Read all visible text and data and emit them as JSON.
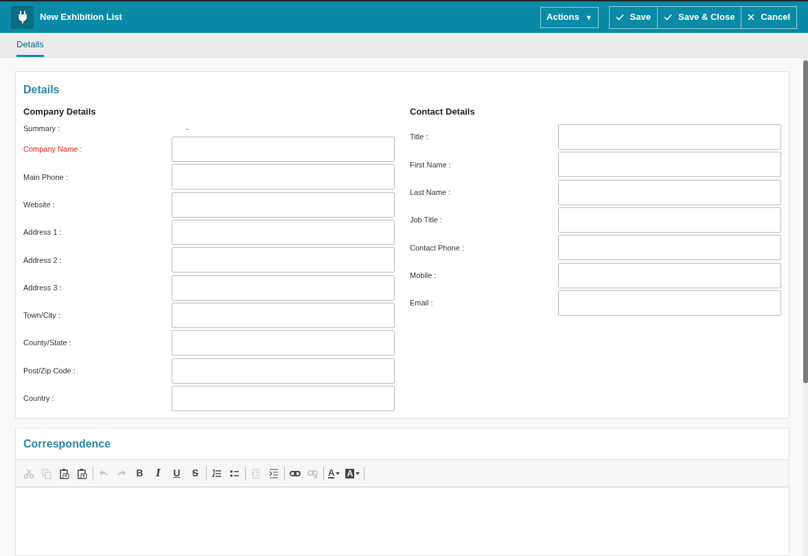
{
  "header": {
    "title": "New Exhibition List",
    "actions_button": {
      "label": "Actions",
      "caret": "▼"
    },
    "buttons": [
      {
        "kind": "save",
        "label": "Save"
      },
      {
        "kind": "save-close",
        "label": "Save & Close"
      },
      {
        "kind": "cancel",
        "label": "Cancel"
      }
    ]
  },
  "tabs": [
    {
      "label": "Details",
      "selected": true
    }
  ],
  "details": {
    "title": "Details",
    "company": {
      "title": "Company Details",
      "summary": {
        "label": "Summary :",
        "value": "-"
      },
      "fields": [
        {
          "label": "Company Name :",
          "required": true
        },
        {
          "label": "Main Phone :",
          "required": false
        },
        {
          "label": "Website :",
          "required": false
        },
        {
          "label": "Address 1 :",
          "required": false
        },
        {
          "label": "Address 2 :",
          "required": false
        },
        {
          "label": "Address 3 :",
          "required": false
        },
        {
          "label": "Town/City :",
          "required": false
        },
        {
          "label": "County/State :",
          "required": false
        },
        {
          "label": "Post/Zip Code :",
          "required": false
        },
        {
          "label": "Country :",
          "required": false
        }
      ]
    },
    "contact": {
      "title": "Contact Details",
      "fields": [
        {
          "label": "Title :",
          "required": false
        },
        {
          "label": "First Name :",
          "required": false
        },
        {
          "label": "Last Name :",
          "required": false
        },
        {
          "label": "Job Title :",
          "required": false
        },
        {
          "label": "Contact Phone :",
          "required": false
        },
        {
          "label": "Mobile :",
          "required": false
        },
        {
          "label": "Email :",
          "required": false
        }
      ]
    }
  },
  "correspondence": {
    "title": "Correspondence",
    "toolbar": [
      [
        {
          "kind": "cut",
          "disabled": true
        },
        {
          "kind": "copy",
          "disabled": true
        },
        {
          "kind": "paste",
          "disabled": false
        },
        {
          "kind": "paste-text",
          "disabled": false
        }
      ],
      [
        {
          "kind": "undo",
          "disabled": true
        },
        {
          "kind": "redo",
          "disabled": true
        },
        {
          "kind": "bold",
          "label": "B",
          "disabled": false
        },
        {
          "kind": "italic",
          "label": "I",
          "disabled": false
        },
        {
          "kind": "underline",
          "label": "U",
          "disabled": false
        },
        {
          "kind": "strike",
          "label": "S",
          "disabled": false
        }
      ],
      [
        {
          "kind": "numbered-list",
          "disabled": false
        },
        {
          "kind": "bulleted-list",
          "disabled": false
        }
      ],
      [
        {
          "kind": "outdent",
          "disabled": true
        },
        {
          "kind": "indent",
          "disabled": false
        }
      ],
      [
        {
          "kind": "link",
          "disabled": false
        },
        {
          "kind": "unlink",
          "disabled": true
        }
      ],
      [
        {
          "kind": "text-color",
          "label": "A",
          "disabled": false
        },
        {
          "kind": "background-color",
          "label": "A",
          "disabled": false
        }
      ]
    ]
  }
}
